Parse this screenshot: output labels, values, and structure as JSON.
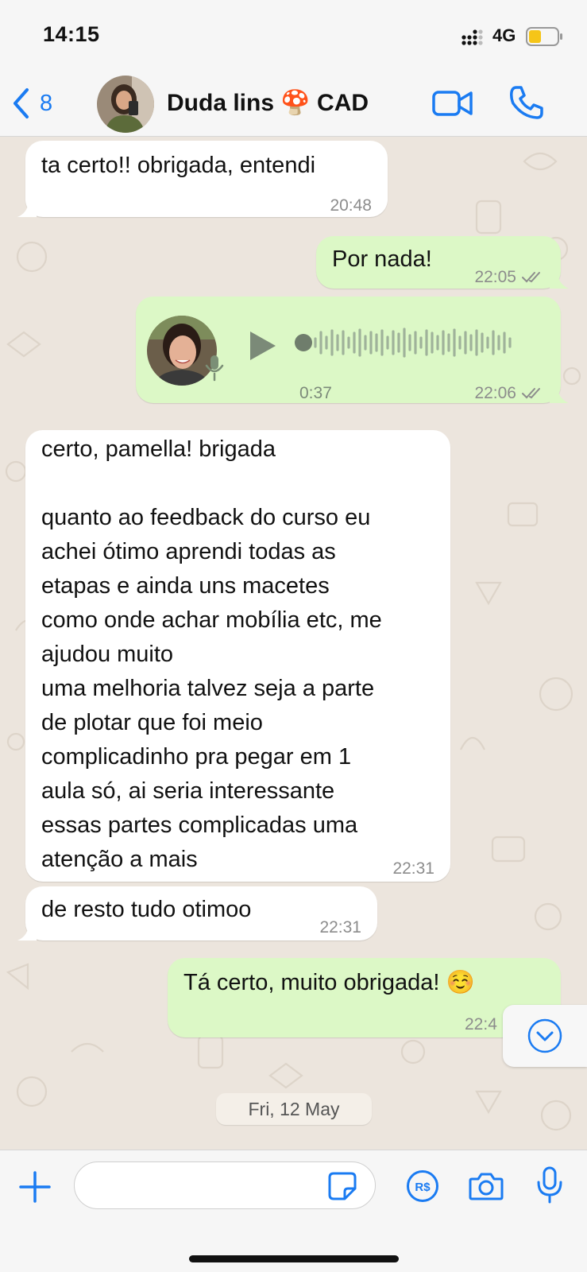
{
  "status_bar": {
    "time": "14:15",
    "network": "4G",
    "battery_color": "#f5c518"
  },
  "header": {
    "back_count": "8",
    "contact_name": "Duda lins 🍄 CAD",
    "accent_color": "#1a7bf2"
  },
  "messages": [
    {
      "direction": "incoming",
      "text": "ta certo!! obrigada, entendi",
      "time": "20:48"
    },
    {
      "direction": "outgoing",
      "text": "Por nada!",
      "time": "22:05",
      "status": "read"
    },
    {
      "direction": "outgoing",
      "type": "voice",
      "duration": "0:37",
      "time": "22:06",
      "status": "read"
    },
    {
      "direction": "incoming",
      "text": "certo, pamella! brigada\n\nquanto ao feedback do curso eu\nachei ótimo aprendi todas as\netapas e ainda uns macetes\ncomo onde achar mobília etc, me\najudou muito\numa melhoria talvez seja a parte\nde plotar que foi meio\ncomplicadinho pra pegar em 1\naula só, ai seria interessante\nessas partes complicadas uma\natenção a mais",
      "time": "22:31"
    },
    {
      "direction": "incoming",
      "text": "de resto tudo otimoo",
      "time": "22:31"
    },
    {
      "direction": "outgoing",
      "text": "Tá certo, muito obrigada! ☺️",
      "time": "22:4"
    }
  ],
  "date_separator": "Fri, 12 May",
  "colors": {
    "incoming_bubble": "#ffffff",
    "outgoing_bubble": "#dcf8c6",
    "chat_background": "#ece5dd"
  },
  "input_bar": {
    "placeholder": "",
    "icons": [
      "plus-icon",
      "sticker-icon",
      "payment-icon",
      "camera-icon",
      "microphone-icon"
    ]
  }
}
